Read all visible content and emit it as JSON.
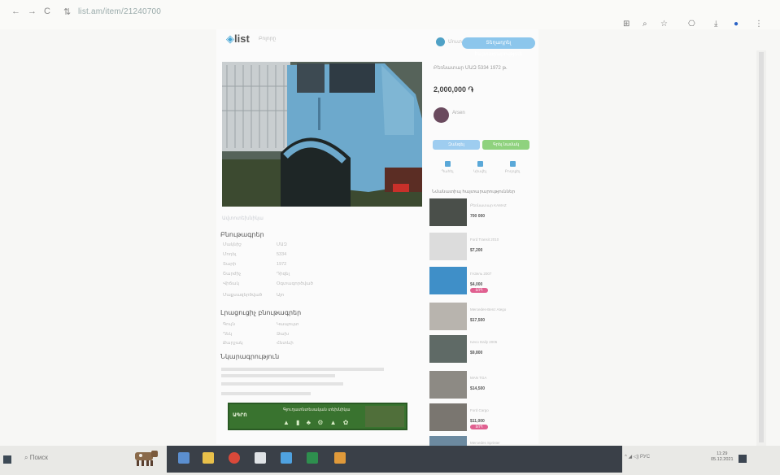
{
  "browser": {
    "url": "list.am/item/21240700",
    "back_icon": "arrow-left-icon",
    "reload_icon": "reload-icon"
  },
  "header": {
    "logo_text": "list",
    "link_text": "Բոլորը",
    "user_text": "Մուտք",
    "post_ad_label": "Տեղադրել հայտարարություն"
  },
  "listing": {
    "photo_meta": "Ավտոտեխնիկա",
    "title": "Բեռնատար ՄԱԶ 5334 1972 թ.",
    "price": "2,000,000 ֏",
    "seller_name": "Arsen",
    "call_label": "Զանգել",
    "message_label": "Գրել նամակ"
  },
  "actions": [
    {
      "label": "Պահել",
      "icon": "bookmark-icon"
    },
    {
      "label": "Կիսվել",
      "icon": "share-icon"
    },
    {
      "label": "Բողոքել",
      "icon": "flag-icon"
    }
  ],
  "specs_title": "Բնութագրեր",
  "specs": [
    {
      "key": "Մակնիշ",
      "value": "ՄԱԶ"
    },
    {
      "key": "Մոդել",
      "value": "5334"
    },
    {
      "key": "Տարի",
      "value": "1972"
    },
    {
      "key": "Շարժիչ",
      "value": "Դիզել"
    },
    {
      "key": "Վիճակ",
      "value": "Օգտագործված"
    },
    {
      "key": "Մաքսազերծված",
      "value": "Այո"
    }
  ],
  "extra_title": "Լրացուցիչ բնութագրեր",
  "extra_specs": [
    {
      "key": "Գույն",
      "value": "Կապույտ"
    },
    {
      "key": "Ղեկ",
      "value": "Ձախ"
    },
    {
      "key": "Քարշակ",
      "value": "Հետևի"
    }
  ],
  "desc_title": "Նկարագրություն",
  "similar_title": "Նմանատիպ հայտարարություններ",
  "similar": [
    {
      "title": "Բեռնատար KAMAZ",
      "price": "700 000",
      "badge": ""
    },
    {
      "title": "Ford Transit 2010",
      "price": "$7,200",
      "badge": ""
    },
    {
      "title": "ГАЗель 2007",
      "price": "$4,000",
      "badge": "ՏՈՊ"
    },
    {
      "title": "Mercedes-Benz Atego",
      "price": "$17,500",
      "badge": ""
    },
    {
      "title": "Iveco Daily 2005",
      "price": "$9,800",
      "badge": ""
    },
    {
      "title": "MAN TGA",
      "price": "$14,500",
      "badge": ""
    },
    {
      "title": "Ford Cargo",
      "price": "$11,000",
      "badge": "ՏՈՊ"
    },
    {
      "title": "Mercedes Sprinter",
      "price": "",
      "badge": ""
    }
  ],
  "banner": {
    "logo": "ԱԳՐՈ",
    "text": "Գյուղատնտեսական տեխնիկա"
  },
  "taskbar": {
    "search_label": "Поиск",
    "lang": "РУС",
    "time": "11:29",
    "date": "05.12.2021"
  },
  "colors": {
    "accent": "#46a6d6",
    "call_button": "#9ecdf0",
    "message_button": "#8fd27e",
    "badge": "#e06090"
  }
}
